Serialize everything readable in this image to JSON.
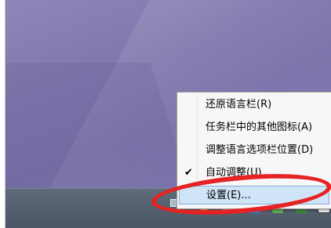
{
  "context_menu": {
    "items": [
      {
        "label": "还原语言栏(R)",
        "checked": false,
        "selected": false
      },
      {
        "label": "任务栏中的其他图标(A)",
        "checked": false,
        "selected": false
      },
      {
        "label": "调整语言选项栏位置(D)",
        "checked": false,
        "selected": false
      },
      {
        "label": "自动调整(U)",
        "checked": true,
        "selected": false
      },
      {
        "label": "设置(E)...",
        "checked": false,
        "selected": true
      }
    ],
    "check_glyph": "✔"
  },
  "colors": {
    "highlight_ring": "#e52324",
    "menu_hover_bg": "#cfe4f7",
    "taskbar": "#56616f",
    "desktop": "#8079ae"
  },
  "icons": [
    "keyboard-icon",
    "tray-icon-color",
    "tray-icon-monitor",
    "tray-icon-blue",
    "tray-icon-green",
    "tray-icon-network"
  ]
}
